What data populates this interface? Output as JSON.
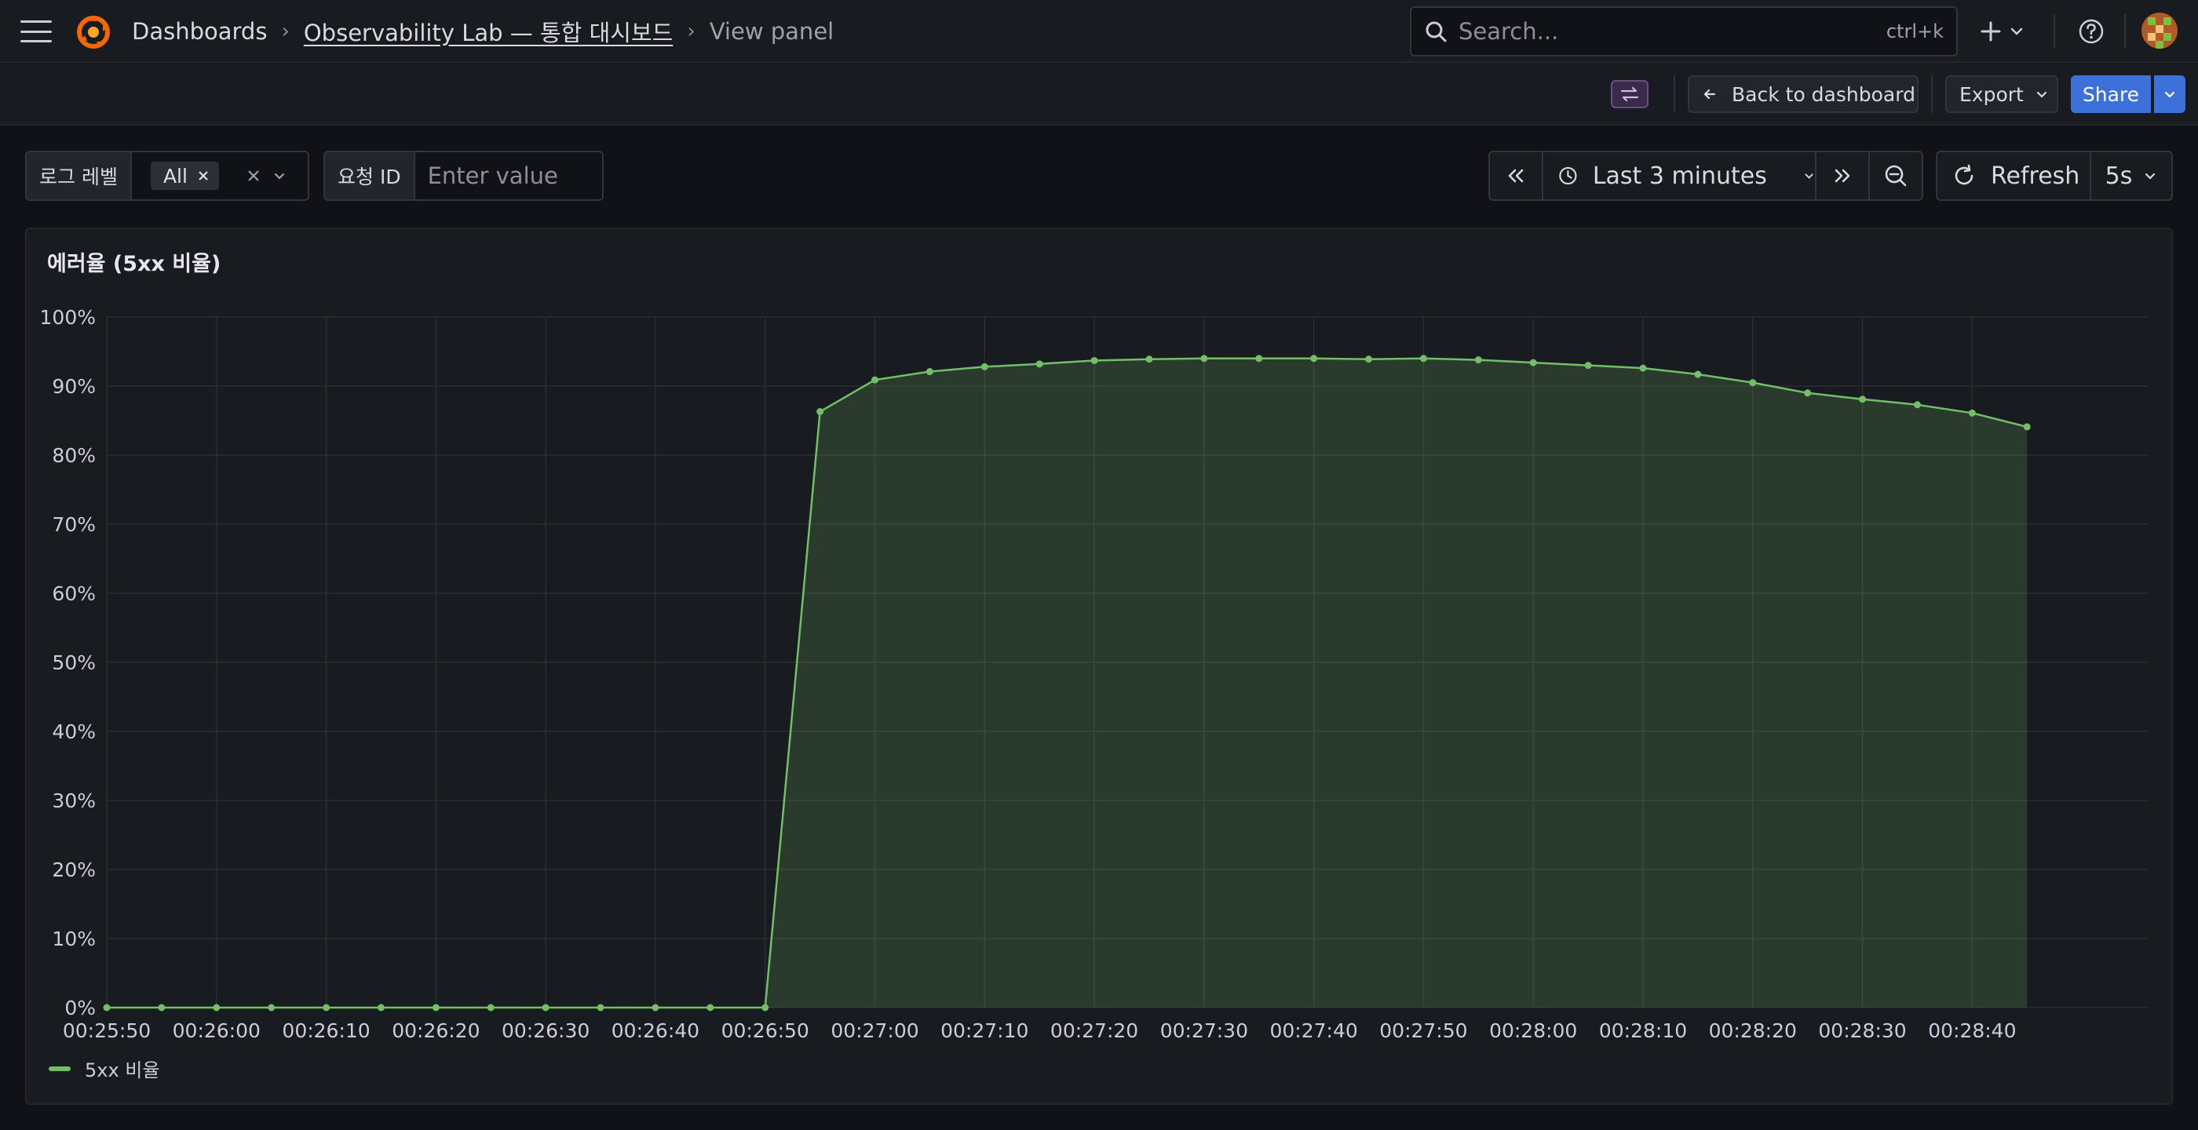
{
  "topbar": {
    "breadcrumb": [
      "Dashboards",
      "Observability Lab — 통합 대시보드",
      "View panel"
    ],
    "search_placeholder": "Search...",
    "search_shortcut": "ctrl+k"
  },
  "toolbar": {
    "back_label": "Back to dashboard",
    "export_label": "Export",
    "share_label": "Share"
  },
  "variables": {
    "log_level": {
      "label": "로그 레벨",
      "value": "All"
    },
    "request_id": {
      "label": "요청 ID",
      "placeholder": "Enter value"
    }
  },
  "time_picker": {
    "range": "Last 3 minutes",
    "refresh_label": "Refresh",
    "interval": "5s"
  },
  "colors": {
    "series": "#73bf69",
    "accent": "#3d71d9"
  },
  "panel": {
    "title": "에러율 (5xx 비율)"
  },
  "chart_data": {
    "type": "area",
    "title": "에러율 (5xx 비율)",
    "ylim": [
      0,
      100
    ],
    "y_ticks": [
      "0%",
      "10%",
      "20%",
      "30%",
      "40%",
      "50%",
      "60%",
      "70%",
      "80%",
      "90%",
      "100%"
    ],
    "x_ticks": [
      "00:25:50",
      "00:26:00",
      "00:26:10",
      "00:26:20",
      "00:26:30",
      "00:26:40",
      "00:26:50",
      "00:27:00",
      "00:27:10",
      "00:27:20",
      "00:27:30",
      "00:27:40",
      "00:27:50",
      "00:28:00",
      "00:28:10",
      "00:28:20",
      "00:28:30",
      "00:28:40"
    ],
    "x_start": "00:25:50",
    "x_step_seconds": 5,
    "legend_position": "bottom-left",
    "grid": true,
    "series": [
      {
        "name": "5xx 비율",
        "color": "#73bf69",
        "values": [
          0,
          0,
          0,
          0,
          0,
          0,
          0,
          0,
          0,
          0,
          0,
          0,
          0,
          86.3,
          90.9,
          92.1,
          92.8,
          93.2,
          93.7,
          93.9,
          94.0,
          94.0,
          94.0,
          93.9,
          94.0,
          93.8,
          93.4,
          93.0,
          92.6,
          91.7,
          90.5,
          89.0,
          88.1,
          87.3,
          86.1,
          84.1
        ]
      }
    ]
  }
}
